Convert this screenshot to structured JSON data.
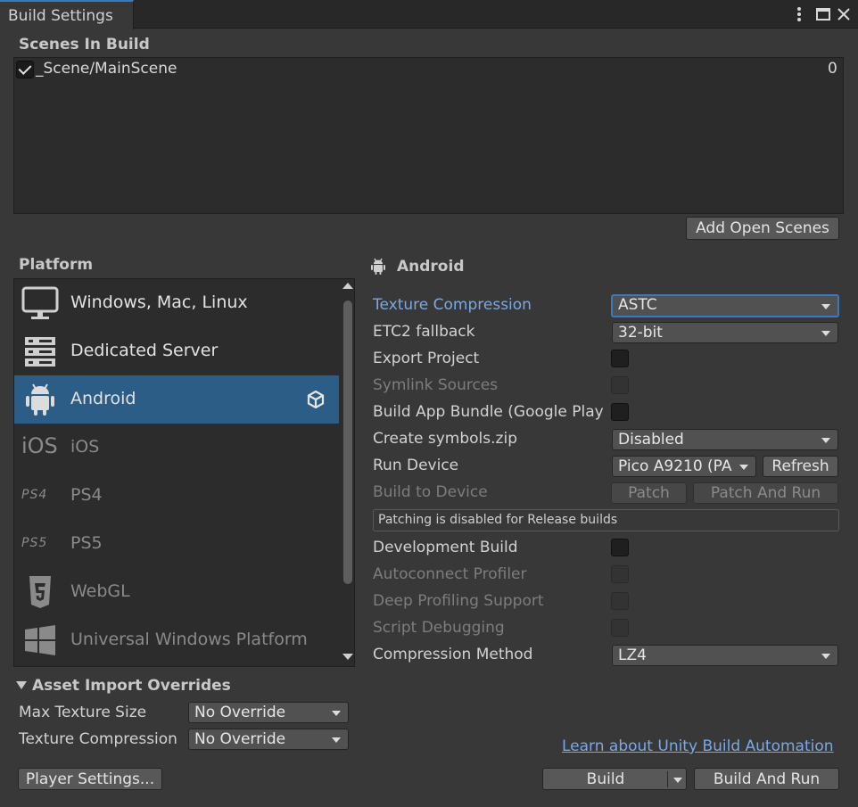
{
  "window": {
    "title": "Build Settings",
    "menu_icon": "kebab-menu-icon",
    "maximize_icon": "maximize-icon",
    "close_icon": "close-icon"
  },
  "scenes": {
    "header": "Scenes In Build",
    "items": [
      {
        "path": "_Scene/MainScene",
        "index": "0",
        "checked": true
      }
    ],
    "add_open_scenes_label": "Add Open Scenes"
  },
  "platform": {
    "header": "Platform",
    "items": [
      {
        "label": "Windows, Mac, Linux",
        "icon": "monitor-icon",
        "selected": false,
        "dim": false
      },
      {
        "label": "Dedicated Server",
        "icon": "server-icon",
        "selected": false,
        "dim": false
      },
      {
        "label": "Android",
        "icon": "android-icon",
        "selected": true,
        "dim": false,
        "badge_icon": "unity-logo-icon"
      },
      {
        "label": "iOS",
        "icon_text": "iOS",
        "selected": false,
        "dim": true
      },
      {
        "label": "PS4",
        "icon_text": "PS4",
        "selected": false,
        "dim": true
      },
      {
        "label": "PS5",
        "icon_text": "PS5",
        "selected": false,
        "dim": true
      },
      {
        "label": "WebGL",
        "icon": "html5-icon",
        "selected": false,
        "dim": true
      },
      {
        "label": "Universal Windows Platform",
        "icon": "windows-logo-icon",
        "selected": false,
        "dim": true
      }
    ]
  },
  "asset_import": {
    "header": "Asset Import Overrides",
    "max_texture_size_label": "Max Texture Size",
    "max_texture_size_value": "No Override",
    "texture_compression_label": "Texture Compression",
    "texture_compression_value": "No Override"
  },
  "android": {
    "header": "Android",
    "texture_compression_label": "Texture Compression",
    "texture_compression_value": "ASTC",
    "etc2_fallback_label": "ETC2 fallback",
    "etc2_fallback_value": "32-bit",
    "export_project_label": "Export Project",
    "symlink_sources_label": "Symlink Sources",
    "build_app_bundle_label": "Build App Bundle (Google Play",
    "create_symbols_label": "Create symbols.zip",
    "create_symbols_value": "Disabled",
    "run_device_label": "Run Device",
    "run_device_value": "Pico A9210 (PA",
    "refresh_label": "Refresh",
    "build_to_device_label": "Build to Device",
    "patch_label": "Patch",
    "patch_and_run_label": "Patch And Run",
    "patching_info": "Patching is disabled for Release builds",
    "development_build_label": "Development Build",
    "autoconnect_profiler_label": "Autoconnect Profiler",
    "deep_profiling_label": "Deep Profiling Support",
    "script_debugging_label": "Script Debugging",
    "compression_method_label": "Compression Method",
    "compression_method_value": "LZ4"
  },
  "footer": {
    "player_settings_label": "Player Settings...",
    "learn_link": "Learn about Unity Build Automation",
    "build_label": "Build",
    "build_and_run_label": "Build And Run"
  },
  "colors": {
    "background": "#383838",
    "selected": "#2c5d87",
    "accent": "#3a79bb",
    "link": "#79a8e8"
  }
}
